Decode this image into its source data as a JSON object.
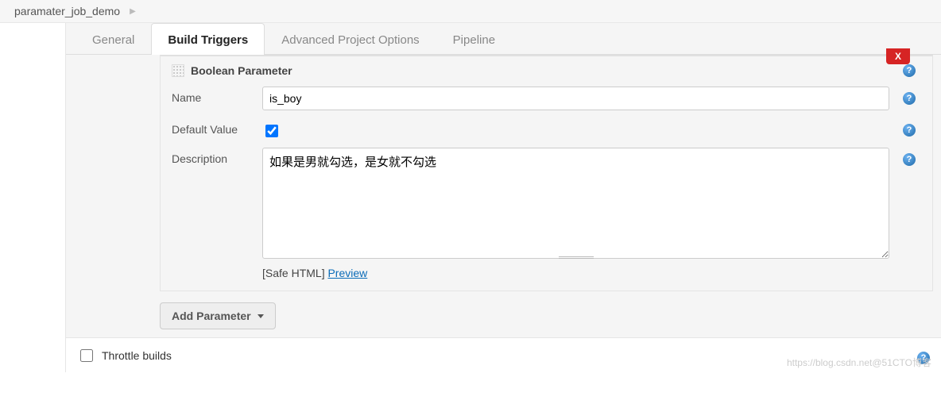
{
  "breadcrumb": {
    "item": "paramater_job_demo"
  },
  "tabs": {
    "general": "General",
    "build_triggers": "Build Triggers",
    "advanced": "Advanced Project Options",
    "pipeline": "Pipeline"
  },
  "param": {
    "title": "Boolean Parameter",
    "close": "X",
    "name_label": "Name",
    "name_value": "is_boy",
    "default_label": "Default Value",
    "default_checked": true,
    "desc_label": "Description",
    "desc_value": "如果是男就勾选，是女就不勾选",
    "safe_html_prefix": "[Safe HTML] ",
    "preview": "Preview"
  },
  "add_parameter": "Add Parameter",
  "throttle": {
    "label": "Throttle builds"
  },
  "help_glyph": "?",
  "watermark": "https://blog.csdn.net@51CTO博客"
}
